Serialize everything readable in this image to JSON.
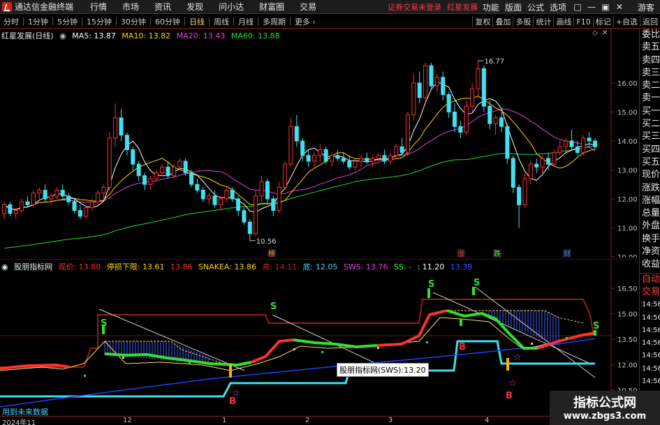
{
  "app": {
    "title": "通达信金融终端"
  },
  "menu": [
    "行情",
    "市场",
    "资讯",
    "发现",
    "问小达",
    "财富圈",
    "交易"
  ],
  "login_warning": "证券交易未登录",
  "stock_link": "红星发展",
  "right_menu": [
    "功能",
    "版面",
    "公式",
    "选项"
  ],
  "window_controls": [
    "□",
    "—",
    "▣",
    "✕"
  ],
  "guest_label": "游客",
  "periods": [
    {
      "label": "分时",
      "active": false
    },
    {
      "label": "1分钟",
      "active": false
    },
    {
      "label": "5分钟",
      "active": false
    },
    {
      "label": "15分钟",
      "active": false
    },
    {
      "label": "30分钟",
      "active": false
    },
    {
      "label": "60分钟",
      "active": false
    },
    {
      "label": "日线",
      "active": true
    },
    {
      "label": "周线",
      "active": false
    },
    {
      "label": "月线",
      "active": false
    },
    {
      "label": "多周期",
      "active": false
    },
    {
      "label": "更多 ›",
      "active": false
    }
  ],
  "toolbar_right": [
    "复权",
    "叠加",
    "多股",
    "统计",
    "画线",
    "F10",
    "标记",
    "+自选",
    "返回"
  ],
  "main_legend": {
    "name": "红星发展(日线)",
    "items": [
      {
        "text": "MA5: 13.87",
        "color": "#ffffff"
      },
      {
        "text": "MA10: 13.82",
        "color": "#ffd700"
      },
      {
        "text": "MA20: 13.43",
        "color": "#e040e0"
      },
      {
        "text": "MA60: 13.88",
        "color": "#20e020"
      }
    ]
  },
  "ind_legend": {
    "name": "股朋指标网",
    "items": [
      {
        "text": "现价: 13.80",
        "color": "#ff3030"
      },
      {
        "text": "停损下限: 13.61",
        "color": "#ffd700"
      },
      {
        "text": "13.86",
        "color": "#ff3030"
      },
      {
        "text": "SNAKEA: 13.86",
        "color": "#ffd700"
      },
      {
        "text": "高: 14.11",
        "color": "#c02020"
      },
      {
        "text": "底: 12.05",
        "color": "#40d0ff"
      },
      {
        "text": "SWS: 13.76",
        "color": "#e040e0"
      },
      {
        "text": "SS: -",
        "color": "#40ff40"
      },
      {
        "text": ": 11.20",
        "color": "#ffffff"
      },
      {
        "text": "13.38",
        "color": "#3050ff"
      }
    ]
  },
  "price_axis": [
    "16.00",
    "15.00",
    "14.00",
    "13.00",
    "12.00",
    "11.00",
    "10.00"
  ],
  "ind_axis": [
    "16.50",
    "15.00",
    "13.50",
    "12.00",
    "10.50"
  ],
  "side_tabs_main": [
    "委比",
    "卖五",
    "卖四",
    "卖三",
    "卖二",
    "卖一",
    "买一",
    "买二",
    "买三",
    "买四",
    "买五",
    "现价",
    "涨跌",
    "涨幅",
    "总量",
    "外盘",
    "换手",
    "净资",
    "收益"
  ],
  "side_tabs_ind": [
    "自动",
    "交易",
    "14:56",
    "14:56",
    "14:56",
    "14:56",
    "14:56",
    "14:56",
    "14:56",
    "14:56"
  ],
  "price_annotations": {
    "high": "16.77",
    "low": "10.56"
  },
  "event_tags": [
    {
      "text": "榜",
      "color": "#ff9040"
    },
    {
      "text": "涨",
      "color": "#ff3030"
    },
    {
      "text": "跌",
      "color": "#40ff40"
    },
    {
      "text": "财",
      "color": "#4080ff"
    }
  ],
  "signals": {
    "buy": "B",
    "sell": "S",
    "star": "☆"
  },
  "tooltip": "股朋指标网(SWS):13.20",
  "future_note": "用到未来数据",
  "dates": [
    "2024年11",
    "12",
    "1",
    "2",
    "3",
    "4"
  ],
  "watermark": {
    "title": "指标公式网",
    "url": "www.zbgs3.com"
  },
  "colors": {
    "up": "#ff3030",
    "down": "#40e0f0",
    "ma5": "#ffffff",
    "ma10": "#ffd700",
    "ma20": "#e040e0",
    "ma60": "#20e020"
  },
  "candles": [
    [
      11.5,
      11.9,
      11.3,
      11.8
    ],
    [
      11.8,
      11.9,
      11.4,
      11.5
    ],
    [
      11.5,
      11.7,
      11.3,
      11.6
    ],
    [
      11.6,
      12.0,
      11.5,
      11.9
    ],
    [
      11.9,
      12.1,
      11.7,
      11.8
    ],
    [
      11.8,
      12.3,
      11.7,
      12.2
    ],
    [
      12.2,
      12.4,
      12.0,
      12.3
    ],
    [
      12.3,
      12.5,
      11.9,
      12.0
    ],
    [
      12.0,
      12.2,
      11.8,
      12.1
    ],
    [
      12.1,
      12.4,
      12.0,
      12.3
    ],
    [
      12.3,
      12.5,
      12.0,
      12.1
    ],
    [
      12.1,
      12.2,
      11.8,
      11.9
    ],
    [
      11.9,
      12.0,
      11.5,
      11.6
    ],
    [
      11.6,
      11.8,
      11.3,
      11.4
    ],
    [
      11.4,
      11.8,
      11.3,
      11.7
    ],
    [
      11.7,
      12.0,
      11.6,
      11.9
    ],
    [
      11.9,
      12.3,
      11.8,
      12.2
    ],
    [
      12.2,
      12.5,
      12.0,
      12.4
    ],
    [
      12.4,
      14.3,
      12.3,
      14.1
    ],
    [
      14.1,
      15.3,
      13.8,
      14.8
    ],
    [
      14.8,
      15.1,
      14.0,
      14.2
    ],
    [
      14.2,
      14.3,
      13.5,
      13.7
    ],
    [
      13.7,
      13.8,
      13.0,
      13.2
    ],
    [
      13.2,
      13.3,
      12.6,
      12.8
    ],
    [
      12.8,
      12.9,
      12.3,
      12.5
    ],
    [
      12.5,
      12.8,
      12.3,
      12.7
    ],
    [
      12.7,
      13.0,
      12.6,
      12.9
    ],
    [
      12.9,
      13.2,
      12.8,
      13.1
    ],
    [
      13.1,
      13.3,
      12.7,
      12.8
    ],
    [
      12.8,
      13.2,
      12.7,
      13.1
    ],
    [
      13.1,
      13.4,
      13.0,
      13.3
    ],
    [
      13.3,
      13.4,
      12.8,
      12.9
    ],
    [
      12.9,
      13.0,
      12.4,
      12.5
    ],
    [
      12.5,
      12.7,
      12.2,
      12.3
    ],
    [
      12.3,
      12.4,
      11.9,
      12.0
    ],
    [
      12.0,
      12.2,
      11.8,
      12.1
    ],
    [
      12.1,
      12.3,
      11.7,
      11.8
    ],
    [
      11.8,
      12.1,
      11.6,
      12.0
    ],
    [
      12.0,
      12.4,
      11.9,
      12.3
    ],
    [
      12.3,
      12.4,
      11.9,
      12.0
    ],
    [
      12.0,
      12.1,
      11.4,
      11.6
    ],
    [
      11.6,
      11.7,
      11.1,
      11.2
    ],
    [
      11.2,
      11.3,
      10.56,
      10.8
    ],
    [
      10.8,
      12.3,
      10.7,
      12.1
    ],
    [
      12.1,
      12.8,
      11.9,
      12.6
    ],
    [
      12.6,
      12.7,
      11.8,
      12.0
    ],
    [
      12.0,
      12.1,
      11.4,
      11.6
    ],
    [
      11.6,
      12.6,
      11.5,
      12.4
    ],
    [
      12.4,
      13.3,
      12.3,
      13.2
    ],
    [
      13.2,
      14.8,
      13.1,
      14.5
    ],
    [
      14.5,
      14.9,
      13.8,
      14.0
    ],
    [
      14.0,
      14.1,
      13.3,
      13.5
    ],
    [
      13.5,
      13.7,
      13.1,
      13.3
    ],
    [
      13.3,
      13.6,
      13.1,
      13.5
    ],
    [
      13.5,
      13.9,
      13.3,
      13.7
    ],
    [
      13.7,
      13.8,
      13.2,
      13.3
    ],
    [
      13.3,
      13.6,
      13.1,
      13.5
    ],
    [
      13.5,
      13.7,
      13.3,
      13.4
    ],
    [
      13.4,
      13.6,
      13.2,
      13.3
    ],
    [
      13.3,
      13.5,
      13.0,
      13.1
    ],
    [
      13.1,
      13.4,
      13.0,
      13.3
    ],
    [
      13.3,
      13.5,
      13.1,
      13.4
    ],
    [
      13.4,
      13.6,
      13.2,
      13.3
    ],
    [
      13.3,
      13.5,
      13.1,
      13.4
    ],
    [
      13.4,
      13.6,
      13.3,
      13.5
    ],
    [
      13.5,
      13.7,
      13.2,
      13.3
    ],
    [
      13.3,
      13.6,
      13.2,
      13.5
    ],
    [
      13.5,
      13.9,
      13.4,
      13.8
    ],
    [
      13.8,
      14.1,
      13.5,
      13.6
    ],
    [
      13.6,
      15.0,
      13.5,
      14.9
    ],
    [
      14.9,
      16.3,
      14.7,
      16.0
    ],
    [
      16.0,
      16.4,
      15.3,
      15.5
    ],
    [
      15.5,
      16.7,
      15.4,
      16.6
    ],
    [
      16.6,
      16.7,
      15.8,
      15.9
    ],
    [
      15.9,
      16.3,
      15.7,
      16.2
    ],
    [
      16.2,
      16.4,
      15.4,
      15.6
    ],
    [
      15.6,
      15.7,
      14.8,
      15.0
    ],
    [
      15.0,
      15.3,
      14.3,
      14.5
    ],
    [
      14.5,
      14.7,
      14.1,
      14.3
    ],
    [
      14.3,
      15.4,
      14.2,
      15.2
    ],
    [
      15.2,
      16.0,
      15.0,
      15.8
    ],
    [
      15.8,
      16.77,
      15.5,
      16.5
    ],
    [
      16.5,
      16.6,
      15.0,
      15.2
    ],
    [
      15.2,
      15.4,
      14.4,
      14.6
    ],
    [
      14.6,
      14.9,
      14.2,
      14.8
    ],
    [
      14.8,
      15.0,
      14.3,
      14.5
    ],
    [
      14.5,
      14.6,
      13.2,
      13.4
    ],
    [
      13.4,
      13.5,
      12.2,
      12.4
    ],
    [
      12.4,
      12.5,
      11.0,
      11.8
    ],
    [
      11.8,
      12.9,
      11.7,
      12.7
    ],
    [
      12.7,
      13.3,
      12.5,
      13.2
    ],
    [
      13.2,
      13.4,
      12.9,
      13.1
    ],
    [
      13.1,
      13.5,
      12.9,
      13.4
    ],
    [
      13.4,
      13.6,
      13.0,
      13.2
    ],
    [
      13.2,
      13.7,
      13.1,
      13.6
    ],
    [
      13.6,
      14.0,
      13.5,
      13.8
    ],
    [
      13.8,
      14.1,
      13.6,
      14.0
    ],
    [
      14.0,
      14.4,
      13.7,
      13.8
    ],
    [
      13.8,
      14.0,
      13.5,
      13.6
    ],
    [
      13.6,
      14.2,
      13.5,
      14.1
    ],
    [
      14.1,
      14.3,
      13.8,
      14.0
    ],
    [
      14.0,
      14.1,
      13.7,
      13.8
    ]
  ]
}
